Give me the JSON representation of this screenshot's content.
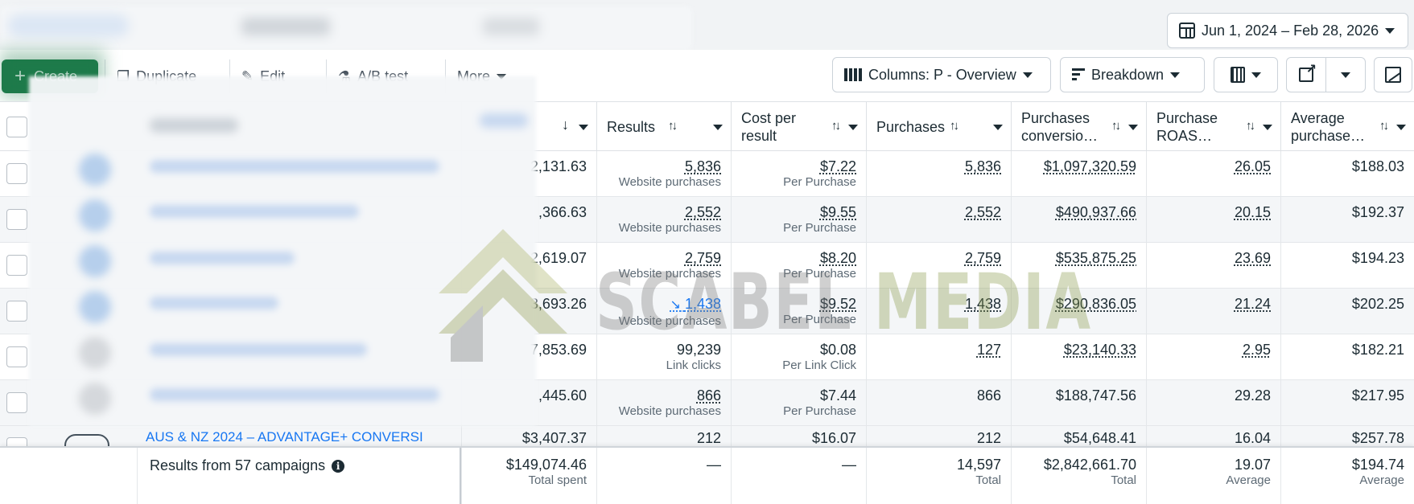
{
  "header": {
    "date_range": "Jun 1, 2024 – Feb 28, 2026"
  },
  "toolbar": {
    "create_label": "Create",
    "duplicate_label": "Duplicate",
    "edit_label": "Edit",
    "ab_test_label": "A/B test",
    "more_label": "More",
    "columns_label": "Columns: P - Overview",
    "breakdown_label": "Breakdown"
  },
  "columns": [
    {
      "key": "results",
      "label": "Results"
    },
    {
      "key": "cost_per_result",
      "label": "Cost per result"
    },
    {
      "key": "purchases",
      "label": "Purchases"
    },
    {
      "key": "purchases_conversion",
      "label": "Purchases conversio…"
    },
    {
      "key": "purchase_roas",
      "label": "Purchase ROAS…"
    },
    {
      "key": "average_purchase",
      "label": "Average purchase…"
    }
  ],
  "rows": [
    {
      "spent": "2,131.63",
      "results": "5,836",
      "results_sub": "Website purchases",
      "cpr": "$7.22",
      "cpr_sub": "Per Purchase",
      "purchases": "5,836",
      "conv_value": "$1,097,320.59",
      "roas": "26.05",
      "avg": "$188.03"
    },
    {
      "spent": ",366.63",
      "results": "2,552",
      "results_sub": "Website purchases",
      "cpr": "$9.55",
      "cpr_sub": "Per Purchase",
      "purchases": "2,552",
      "conv_value": "$490,937.66",
      "roas": "20.15",
      "avg": "$192.37"
    },
    {
      "spent": "2,619.07",
      "results": "2,759",
      "results_sub": "Website purchases",
      "cpr": "$8.20",
      "cpr_sub": "Per Purchase",
      "purchases": "2,759",
      "conv_value": "$535,875.25",
      "roas": "23.69",
      "avg": "$194.23"
    },
    {
      "spent": "3,693.26",
      "results": "1,438",
      "results_sub": "Website purchases",
      "cpr": "$9.52",
      "cpr_sub": "Per Purchase",
      "purchases": "1,438",
      "conv_value": "$290,836.05",
      "roas": "21.24",
      "avg": "$202.25"
    },
    {
      "spent": "7,853.69",
      "results": "99,239",
      "results_sub": "Link clicks",
      "cpr": "$0.08",
      "cpr_sub": "Per Link Click",
      "purchases": "127",
      "conv_value": "$23,140.33",
      "roas": "2.95",
      "avg": "$182.21"
    },
    {
      "spent": ",445.60",
      "results": "866",
      "results_sub": "Website purchases",
      "cpr": "$7.44",
      "cpr_sub": "Per Purchase",
      "purchases": "866",
      "conv_value": "$188,747.56",
      "roas": "29.28",
      "avg": "$217.95"
    }
  ],
  "partial_row": {
    "campaign": "AUS & NZ 2024 – ADVANTAGE+ CONVERSI",
    "spent": "$3,407.37",
    "results": "212",
    "cpr": "$16.07",
    "purchases": "212",
    "conv_value": "$54,648.41",
    "roas": "16.04",
    "avg": "$257.78"
  },
  "footer": {
    "label": "Results from 57 campaigns",
    "spent": "$149,074.46",
    "spent_sub": "Total spent",
    "results": "—",
    "cpr": "—",
    "purchases": "14,597",
    "purchases_sub": "Total",
    "conv_value": "$2,842,661.70",
    "conv_value_sub": "Total",
    "roas": "19.07",
    "roas_sub": "Average",
    "avg": "$194.74",
    "avg_sub": "Average"
  },
  "watermark": {
    "text_a": "SCABEL",
    "text_b": "MEDIA"
  },
  "colors": {
    "create_green": "#1e7a4a",
    "link_blue": "#1877f2",
    "text": "#1c2b33"
  }
}
